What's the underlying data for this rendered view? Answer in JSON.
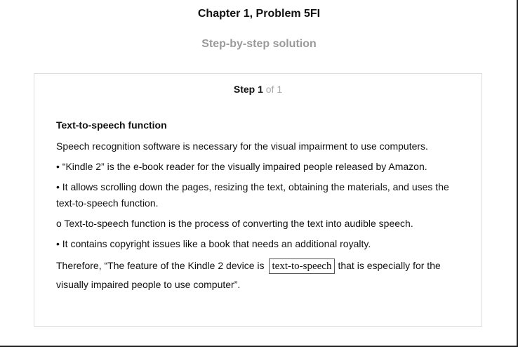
{
  "header": {
    "chapter_title": "Chapter 1, Problem 5FI",
    "subtitle": "Step-by-step solution"
  },
  "step": {
    "label": "Step 1",
    "of_text": "of 1"
  },
  "content": {
    "heading": "Text-to-speech function",
    "paragraphs": [
      "Speech recognition software is necessary for the visual impairment to use computers.",
      "• “Kindle 2” is the e-book reader for the visually impaired people released by Amazon.",
      "• It allows scrolling down the pages, resizing the text, obtaining the materials, and uses the text-to-speech function.",
      "o Text-to-speech function is the process of converting the text into audible speech.",
      "• It contains copyright issues like a book that needs an additional royalty."
    ],
    "conclusion_before": "Therefore, “The feature of the Kindle 2 device is",
    "answer": "text-to-speech",
    "conclusion_after": "that is especially for the visually impaired people to use computer”."
  }
}
